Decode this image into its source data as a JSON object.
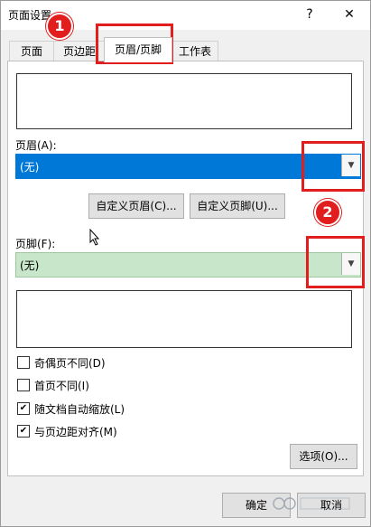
{
  "window": {
    "title": "页面设置",
    "help_glyph": "?",
    "close_glyph": "✕"
  },
  "tabs": [
    {
      "label": "页面"
    },
    {
      "label": "页边距"
    },
    {
      "label": "页眉/页脚",
      "active": true
    },
    {
      "label": "工作表"
    }
  ],
  "header": {
    "label": "页眉(A):",
    "value": "(无)",
    "highlight_color": "#0078d7"
  },
  "buttons": {
    "custom_header": "自定义页眉(C)...",
    "custom_footer": "自定义页脚(U)...",
    "options": "选项(O)...",
    "ok": "确定",
    "cancel": "取消"
  },
  "footer": {
    "label": "页脚(F):",
    "value": "(无)",
    "highlight_color": "#c8e6c9"
  },
  "checkboxes": [
    {
      "label": "奇偶页不同(D)",
      "checked": false
    },
    {
      "label": "首页不同(I)",
      "checked": false
    },
    {
      "label": "随文档自动缩放(L)",
      "checked": true
    },
    {
      "label": "与页边距对齐(M)",
      "checked": true
    }
  ],
  "annotations": [
    {
      "number": "1"
    },
    {
      "number": "2"
    }
  ],
  "colors": {
    "annotation_red": "#e11d1d"
  }
}
